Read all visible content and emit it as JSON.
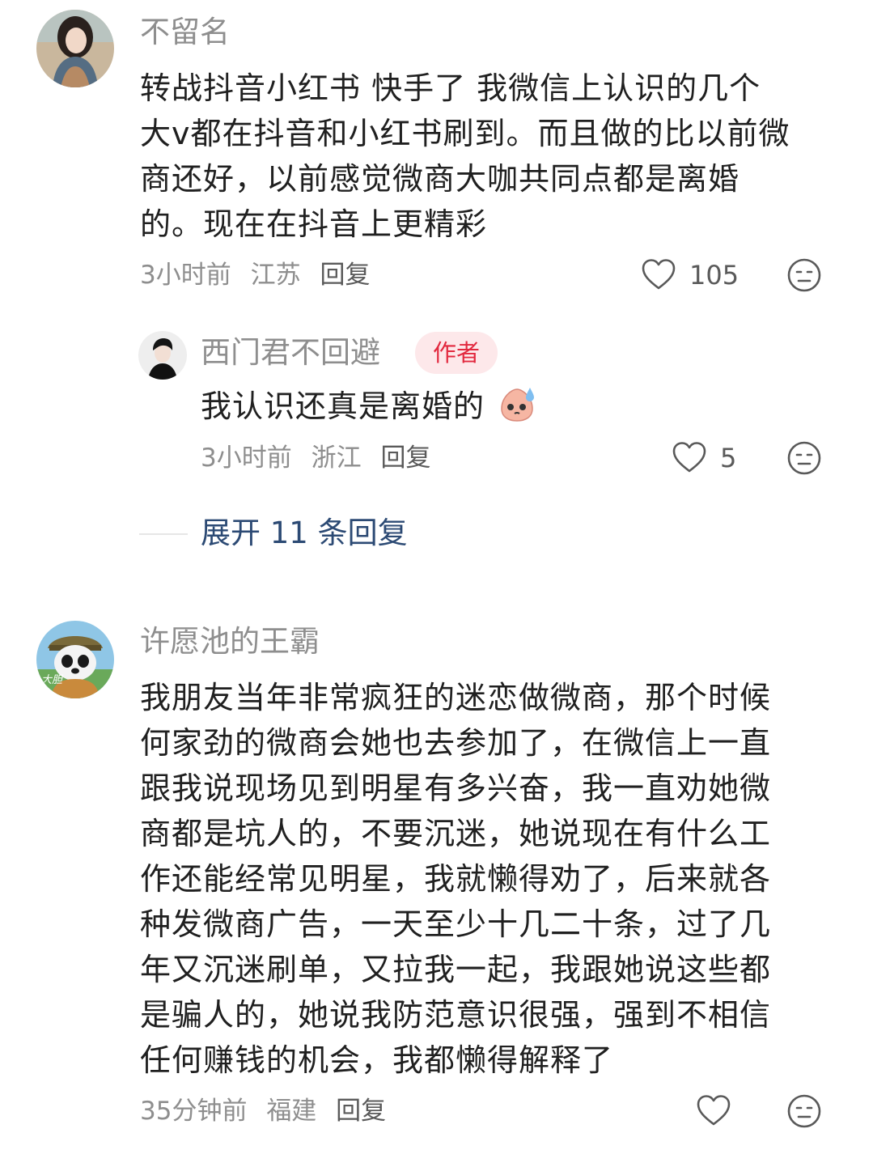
{
  "comments": [
    {
      "username": "不留名",
      "lines": [
        "转战抖音小红书 快手了 我微信上认识的几个",
        "大v都在抖音和小红书刷到。而且做的比以前微",
        "商还好，以前感觉微商大咖共同点都是离婚",
        "的。现在在抖音上更精彩"
      ],
      "time": "3小时前",
      "location": "江苏",
      "reply_label": "回复",
      "likes": "105",
      "avatar_icon": "woman-portrait-avatar"
    },
    {
      "username": "许愿池的王霸",
      "lines": [
        "我朋友当年非常疯狂的迷恋做微商，那个时候",
        "何家劲的微商会她也去参加了，在微信上一直",
        "跟我说现场见到明星有多兴奋，我一直劝她微",
        "商都是坑人的，不要沉迷，她说现在有什么工",
        "作还能经常见明星，我就懒得劝了，后来就各",
        "种发微商广告，一天至少十几二十条，过了几",
        "年又沉迷刷单，又拉我一起，我跟她说这些都",
        "是骗人的，她说我防范意识很强，强到不相信",
        "任何赚钱的机会，我都懒得解释了"
      ],
      "time": "35分钟前",
      "location": "福建",
      "reply_label": "回复",
      "likes": "",
      "avatar_icon": "panda-avatar",
      "avatar_caption": "大胆"
    }
  ],
  "reply": {
    "username": "西门君不回避",
    "badge": "作者",
    "text": "我认识还真是离婚的",
    "emoji_icon": "sweating-peach-emoji-icon",
    "time": "3小时前",
    "location": "浙江",
    "reply_label": "回复",
    "likes": "5",
    "avatar_icon": "man-portrait-avatar"
  },
  "expand": {
    "label": "展开 11 条回复"
  },
  "colors": {
    "author_badge_bg": "#fde8ea",
    "author_badge_text": "#e2293f",
    "expand_link": "#2c4a74",
    "meta_gray": "#8e8e8e"
  }
}
